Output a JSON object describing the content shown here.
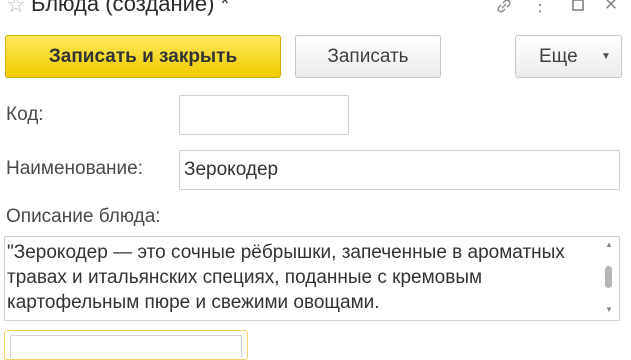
{
  "window": {
    "title": "Блюда (создание) *",
    "icons": {
      "favorite": "star-icon",
      "link": "link-icon",
      "menu": "more-menu-icon",
      "maximize": "maximize-icon",
      "close": "close-icon"
    }
  },
  "toolbar": {
    "write_close_label": "Записать и закрыть",
    "write_label": "Записать",
    "more_label": "Еще"
  },
  "form": {
    "code_label": "Код:",
    "code_value": "",
    "name_label": "Наименование:",
    "name_value": "Зерокодер",
    "description_label": "Описание блюда:",
    "description_value": "\"Зерокодер — это сочные рёбрышки, запеченные в ароматных травах и итальянских специях, поданные с кремовым картофельным пюре и свежими овощами."
  },
  "colors": {
    "primary_button_top": "#fde95c",
    "primary_button_bottom": "#f1ca00",
    "focus_border": "#f0d36a"
  }
}
